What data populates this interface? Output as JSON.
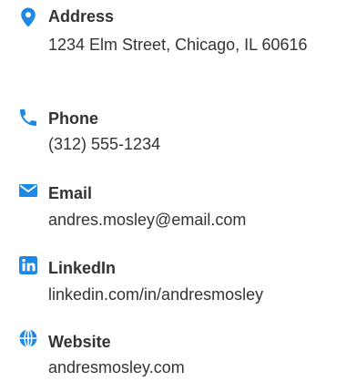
{
  "accent_color": "#1e88e5",
  "text_color": "#333333",
  "contacts": [
    {
      "icon": "map-pin-icon",
      "label": "Address",
      "value": "1234 Elm Street, Chicago, IL 60616"
    },
    {
      "icon": "phone-icon",
      "label": "Phone",
      "value": "(312) 555-1234"
    },
    {
      "icon": "envelope-icon",
      "label": "Email",
      "value": "andres.mosley@email.com"
    },
    {
      "icon": "linkedin-icon",
      "label": "LinkedIn",
      "value": "linkedin.com/in/andresmosley"
    },
    {
      "icon": "globe-icon",
      "label": "Website",
      "value": "andresmosley.com"
    }
  ]
}
